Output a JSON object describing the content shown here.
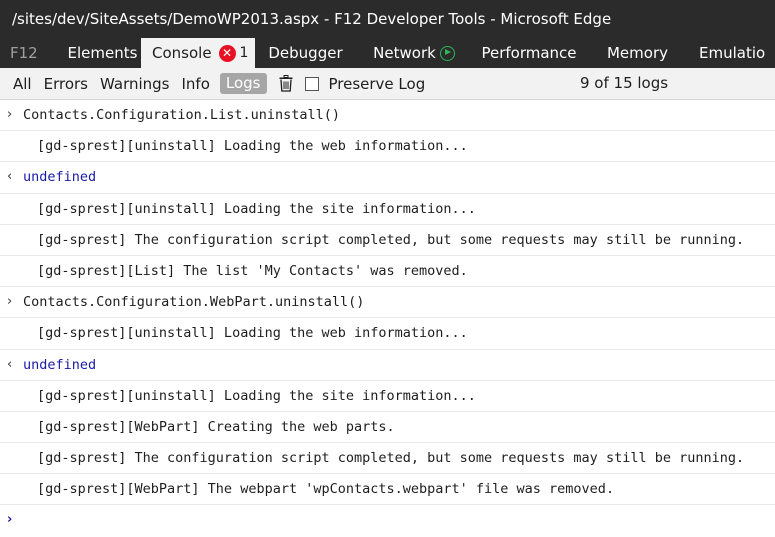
{
  "window": {
    "title": "/sites/dev/SiteAssets/DemoWP2013.aspx - F12 Developer Tools - Microsoft Edge"
  },
  "tabs": {
    "f12": "F12",
    "elements": "Elements",
    "console": "Console",
    "console_error_count": "1",
    "debugger": "Debugger",
    "network": "Network",
    "performance": "Performance",
    "memory": "Memory",
    "emulation": "Emulatio"
  },
  "toolbar": {
    "all": "All",
    "errors": "Errors",
    "warnings": "Warnings",
    "info": "Info",
    "logs": "Logs",
    "preserve_log": "Preserve Log",
    "preserve_log_checked": false,
    "log_count": "9 of 15 logs"
  },
  "console": {
    "rows": [
      {
        "kind": "input",
        "glyph": "›",
        "text": "Contacts.Configuration.List.uninstall()"
      },
      {
        "kind": "log",
        "text": "[gd-sprest][uninstall] Loading the web information..."
      },
      {
        "kind": "result",
        "glyph": "‹",
        "text": "undefined"
      },
      {
        "kind": "log",
        "text": "[gd-sprest][uninstall] Loading the site information..."
      },
      {
        "kind": "log",
        "text": "[gd-sprest] The configuration script completed, but some requests may still be running."
      },
      {
        "kind": "log",
        "text": "[gd-sprest][List] The list 'My Contacts' was removed."
      },
      {
        "kind": "input",
        "glyph": "›",
        "text": "Contacts.Configuration.WebPart.uninstall()"
      },
      {
        "kind": "log",
        "text": "[gd-sprest][uninstall] Loading the web information..."
      },
      {
        "kind": "result",
        "glyph": "‹",
        "text": "undefined"
      },
      {
        "kind": "log",
        "text": "[gd-sprest][uninstall] Loading the site information..."
      },
      {
        "kind": "log",
        "text": "[gd-sprest][WebPart] Creating the web parts."
      },
      {
        "kind": "log",
        "text": "[gd-sprest] The configuration script completed, but some requests may still be running."
      },
      {
        "kind": "log",
        "text": "[gd-sprest][WebPart] The webpart 'wpContacts.webpart' file was removed."
      }
    ],
    "prompt_glyph": "›"
  },
  "colors": {
    "chrome_dark": "#2b2b2b",
    "toolbar_bg": "#f2f2f2",
    "error_badge": "#e81123",
    "network_play": "#2fb65a",
    "result_text": "#1a1aa6"
  }
}
